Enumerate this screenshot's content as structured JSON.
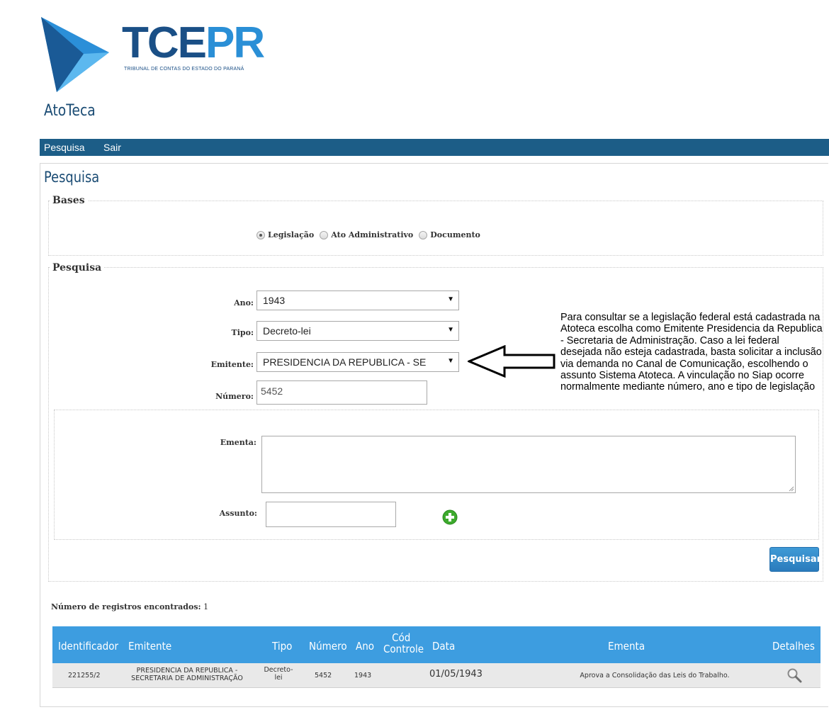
{
  "brand": {
    "logo_text_1": "TCE",
    "logo_text_2": "PR",
    "logo_subtitle": "TRIBUNAL DE CONTAS DO ESTADO DO PARANÁ",
    "app_title": "AtoTeca"
  },
  "nav": {
    "items": [
      {
        "label": "Pesquisa"
      },
      {
        "label": "Sair"
      }
    ]
  },
  "page": {
    "title": "Pesquisa"
  },
  "bases": {
    "legend": "Bases",
    "options": [
      {
        "label": "Legislação",
        "checked": true
      },
      {
        "label": "Ato Administrativo",
        "checked": false
      },
      {
        "label": "Documento",
        "checked": false
      }
    ]
  },
  "search": {
    "legend": "Pesquisa",
    "ano": {
      "label": "Ano:",
      "value": "1943"
    },
    "tipo": {
      "label": "Tipo:",
      "value": "Decreto-lei"
    },
    "emitente": {
      "label": "Emitente:",
      "value": "PRESIDENCIA DA REPUBLICA - SE"
    },
    "numero": {
      "label": "Número:",
      "value": "5452"
    },
    "ementa": {
      "label": "Ementa:",
      "value": ""
    },
    "assunto": {
      "label": "Assunto:",
      "value": ""
    },
    "submit_label": "Pesquisar"
  },
  "annotation": {
    "text": "Para consultar se a legislação federal está cadastrada na Atoteca escolha como Emitente Presidencia da Republica - Secretaria de Administração. Caso a lei federal desejada não esteja cadastrada, basta solicitar a inclusão via demanda no Canal de Comunicação, escolhendo o assunto Sistema Atoteca. A vinculação no Siap ocorre normalmente mediante número, ano e tipo de legislação"
  },
  "results": {
    "count_label": "Número de registros encontrados:",
    "count_value": "1",
    "columns": [
      "Identificador",
      "Emitente",
      "Tipo",
      "Número",
      "Ano",
      "Cód Controle",
      "Data",
      "Ementa",
      "Detalhes"
    ],
    "rows": [
      {
        "identificador": "221255/2",
        "emitente": "PRESIDENCIA DA REPUBLICA - SECRETARIA DE ADMINISTRAÇÃO",
        "tipo": "Decreto-lei",
        "numero": "5452",
        "ano": "1943",
        "cod_controle": "",
        "data": "01/05/1943",
        "ementa": "Aprova a Consolidação das Leis do Trabalho.",
        "detalhes_icon": "magnifier-icon"
      }
    ]
  },
  "colors": {
    "navbar": "#1c5d87",
    "table_header": "#3d9de0",
    "button": "#2a7bbc",
    "add_icon": "#3daa2d"
  }
}
